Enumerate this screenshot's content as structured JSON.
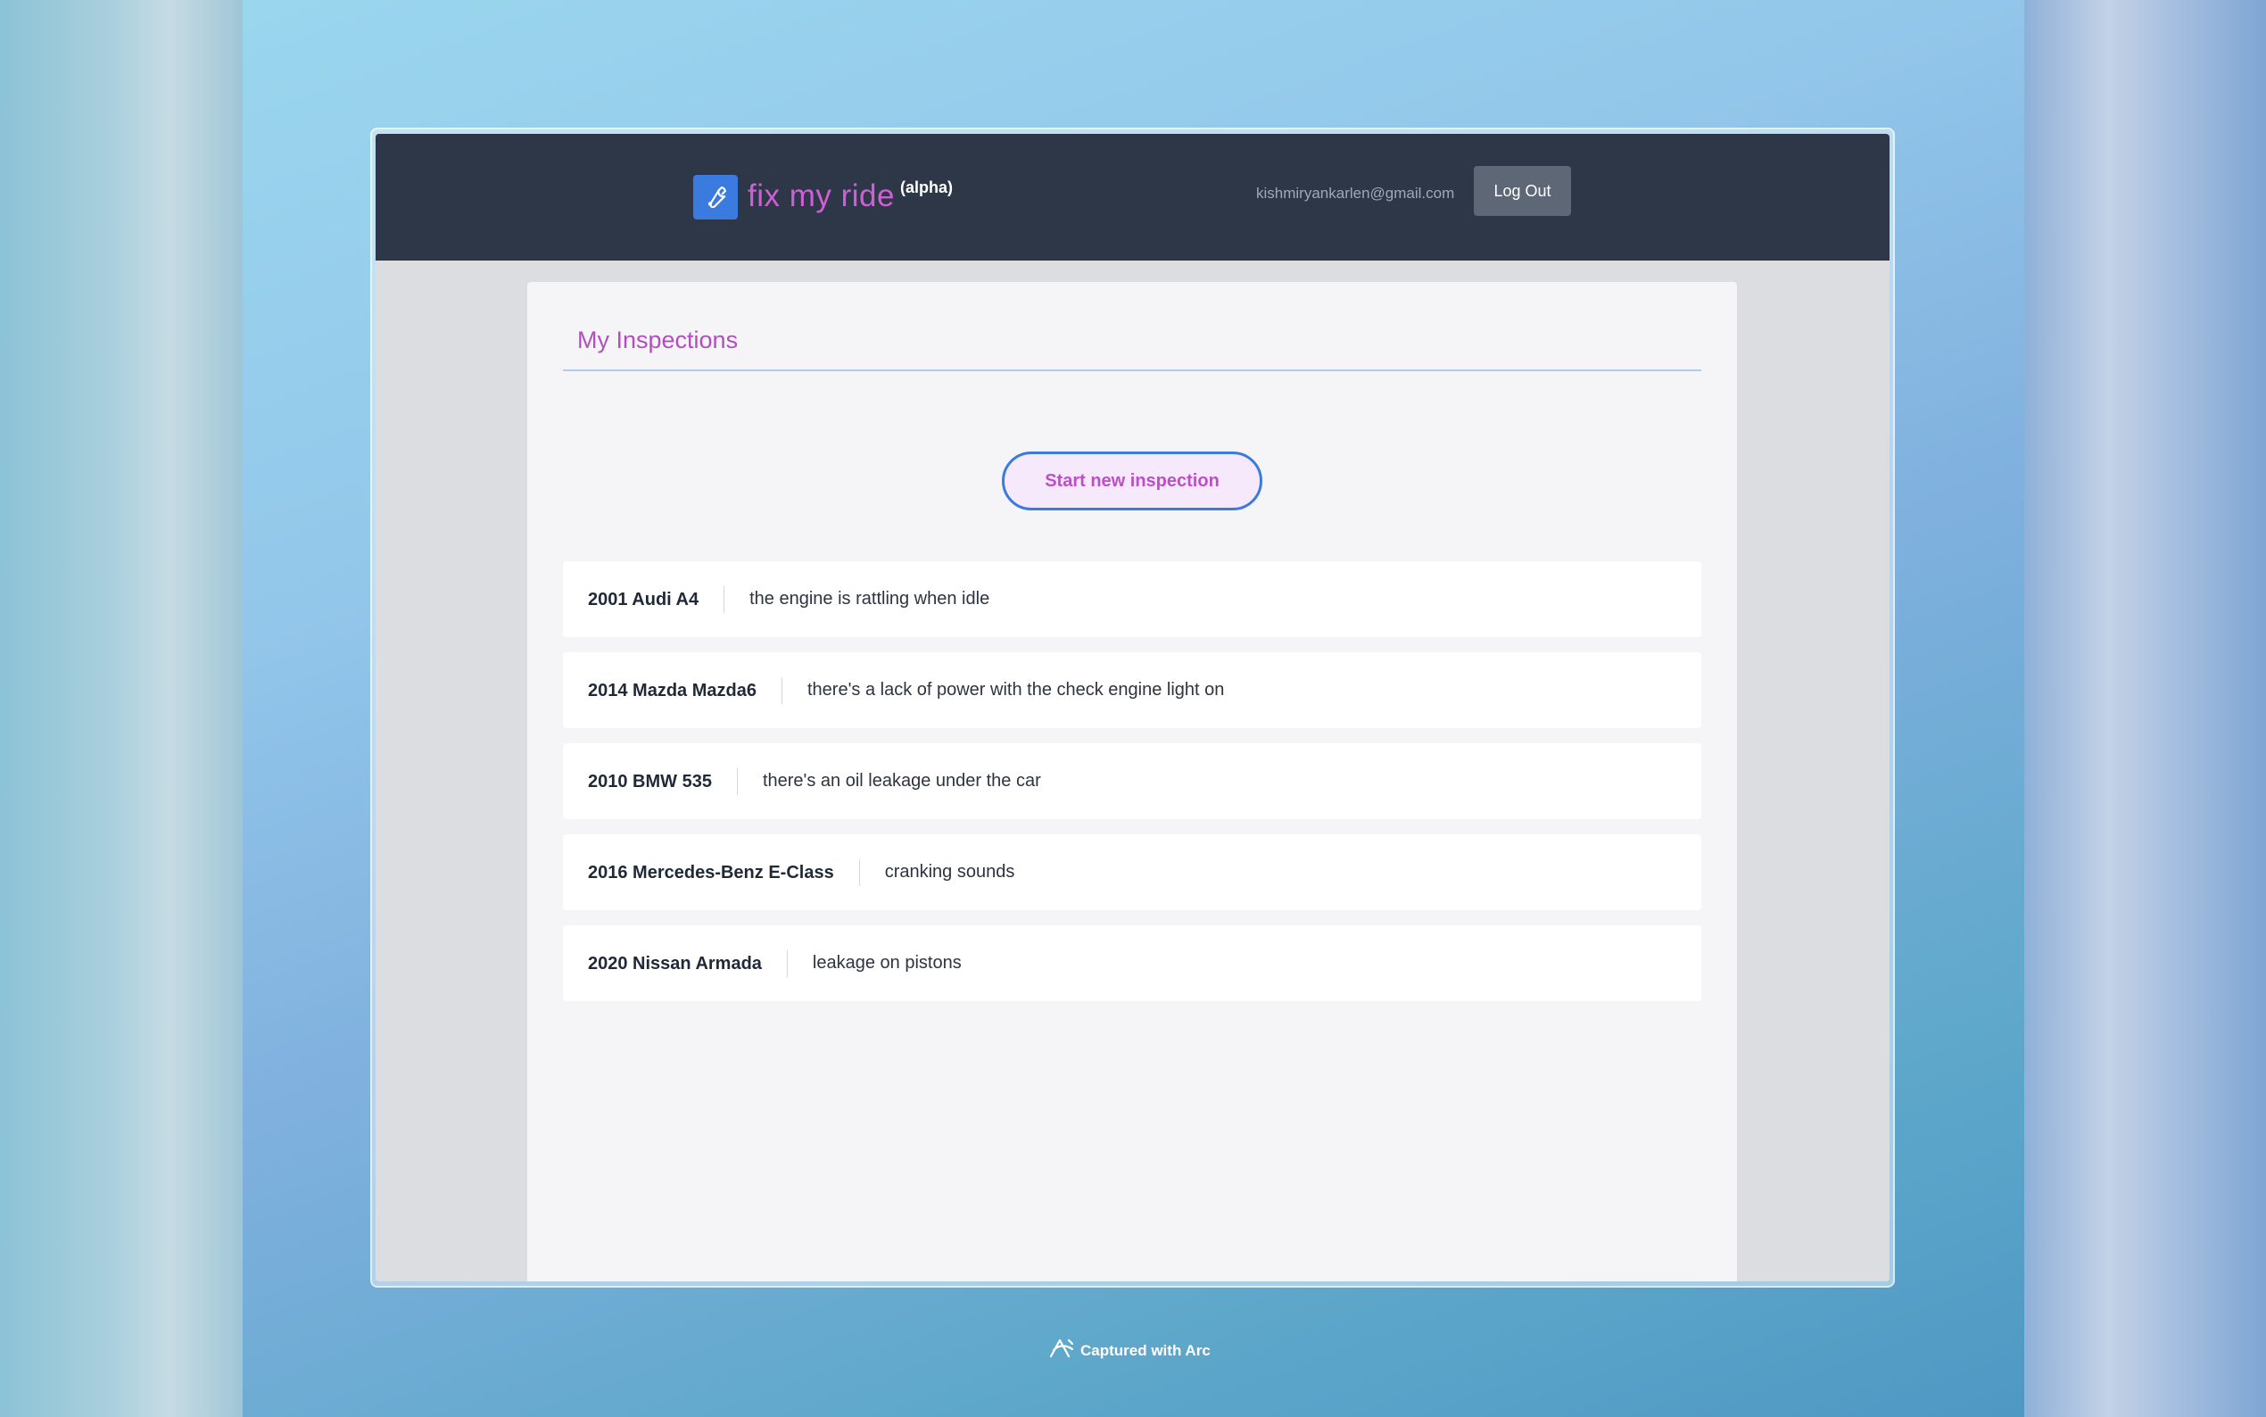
{
  "header": {
    "brand_name": "fix my ride",
    "brand_tag": "(alpha)",
    "user_email": "kishmiryankarlen@gmail.com",
    "logout_label": "Log Out",
    "logo_icon": "wrench-icon"
  },
  "main": {
    "title": "My Inspections",
    "start_button_label": "Start new inspection",
    "inspections": [
      {
        "car": "2001 Audi A4",
        "issue": "the engine is rattling when idle"
      },
      {
        "car": "2014 Mazda Mazda6",
        "issue": "there's a lack of power with the check engine light on"
      },
      {
        "car": "2010 BMW 535",
        "issue": "there's an oil leakage under the car"
      },
      {
        "car": "2016 Mercedes-Benz E-Class",
        "issue": "cranking sounds"
      },
      {
        "car": "2020 Nissan Armada",
        "issue": "leakage on pistons"
      }
    ]
  },
  "footer": {
    "captured_label": "Captured with Arc"
  },
  "colors": {
    "navbar": "#2d3748",
    "brand": "#cf5fd4",
    "accent_blue": "#3b7be0",
    "title_purple": "#b24ec0"
  }
}
